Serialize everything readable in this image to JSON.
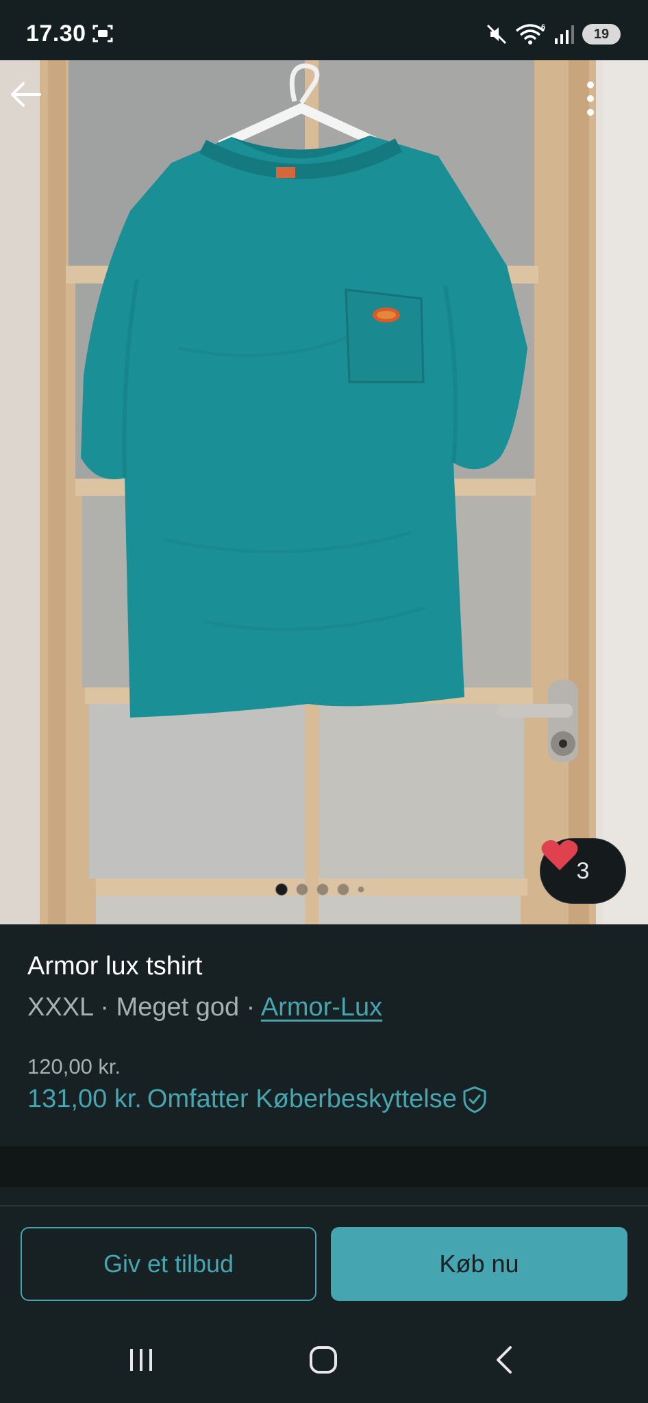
{
  "status_bar": {
    "time": "17.30",
    "battery": "19"
  },
  "listing": {
    "title": "Armor lux tshirt",
    "size": "XXXL",
    "condition": "Meget god",
    "separator": " · ",
    "brand": "Armor-Lux",
    "price": "120,00 kr.",
    "total_price": "131,00 kr.",
    "protection_label": "Omfatter Køberbeskyttelse",
    "favorites_count": "3",
    "photo_count": 5,
    "active_photo": 1
  },
  "actions": {
    "offer_label": "Giv et tilbud",
    "buy_label": "Køb nu"
  },
  "colors": {
    "background": "#172022",
    "accent": "#45a5b0",
    "heart": "#e0414f",
    "shirt": "#1b8f96"
  },
  "icons": {
    "back": "arrow-left-icon",
    "more": "more-vertical-icon",
    "favorite": "heart-icon",
    "protection": "shield-check-icon",
    "nav_recents": "recents-icon",
    "nav_home": "home-icon",
    "nav_back": "chevron-left-icon"
  }
}
